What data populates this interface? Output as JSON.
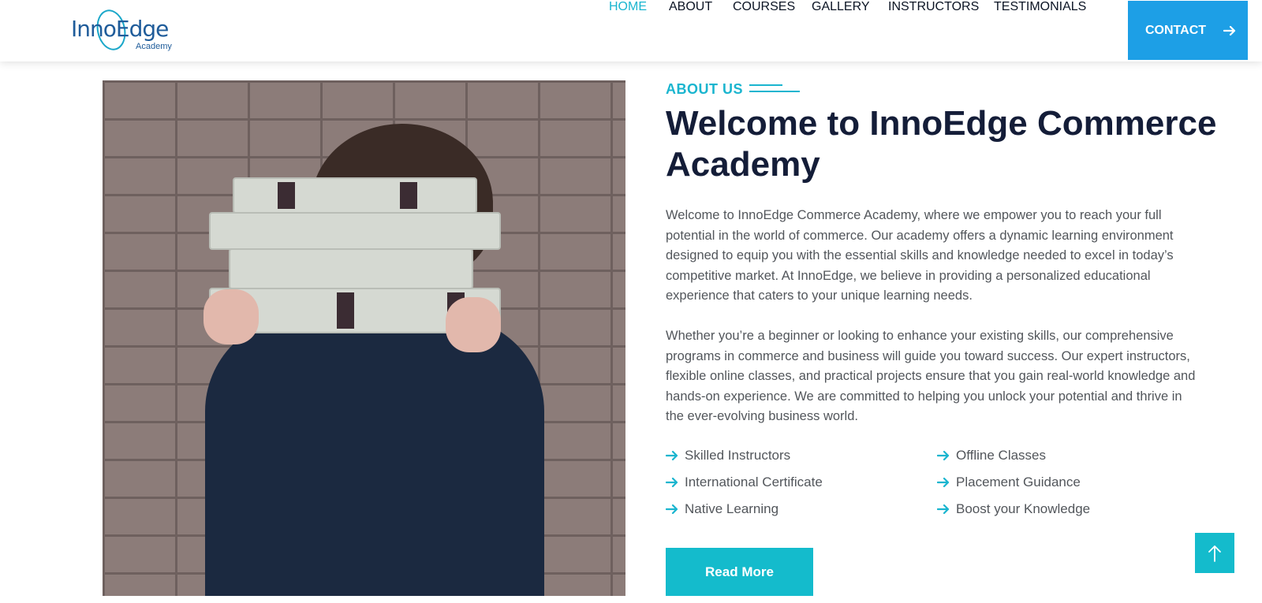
{
  "brand": {
    "logo_text": "InnoEdge",
    "logo_sub": "Academy"
  },
  "nav": {
    "items": [
      {
        "label": "HOME",
        "active": true
      },
      {
        "label": "ABOUT",
        "active": false
      },
      {
        "label": "COURSES",
        "active": false
      },
      {
        "label": "GALLERY",
        "active": false
      },
      {
        "label": "INSTRUCTORS",
        "active": false
      },
      {
        "label": "TESTIMONIALS",
        "active": false
      }
    ],
    "contact_label": "CONTACT"
  },
  "about": {
    "eyebrow": "ABOUT US",
    "title": "Welcome to InnoEdge Commerce Academy",
    "paragraph_1": "Welcome to InnoEdge Commerce Academy, where we empower you to reach your full potential in the world of commerce. Our academy offers a dynamic learning environment designed to equip you with the essential skills and knowledge needed to excel in today’s competitive market. At InnoEdge, we believe in providing a personalized educational experience that caters to your unique learning needs.",
    "paragraph_2": "Whether you’re a beginner or looking to enhance your existing skills, our comprehensive programs in commerce and business will guide you toward success. Our expert instructors, flexible online classes, and practical projects ensure that you gain real-world knowledge and hands-on experience. We are committed to helping you unlock your potential and thrive in the ever-evolving business world.",
    "features": [
      "Skilled Instructors",
      "Offline Classes",
      "International Certificate",
      "Placement Guidance",
      "Native Learning",
      "Boost your Knowledge"
    ],
    "read_more_label": "Read More"
  },
  "colors": {
    "accent": "#1ab5cf",
    "contact_bg": "#1d9fe6",
    "heading": "#141d38",
    "body_text": "#52565b"
  },
  "icons": {
    "feature": "arrow-right-icon",
    "contact": "arrow-right-icon",
    "to_top": "arrow-up-icon"
  }
}
